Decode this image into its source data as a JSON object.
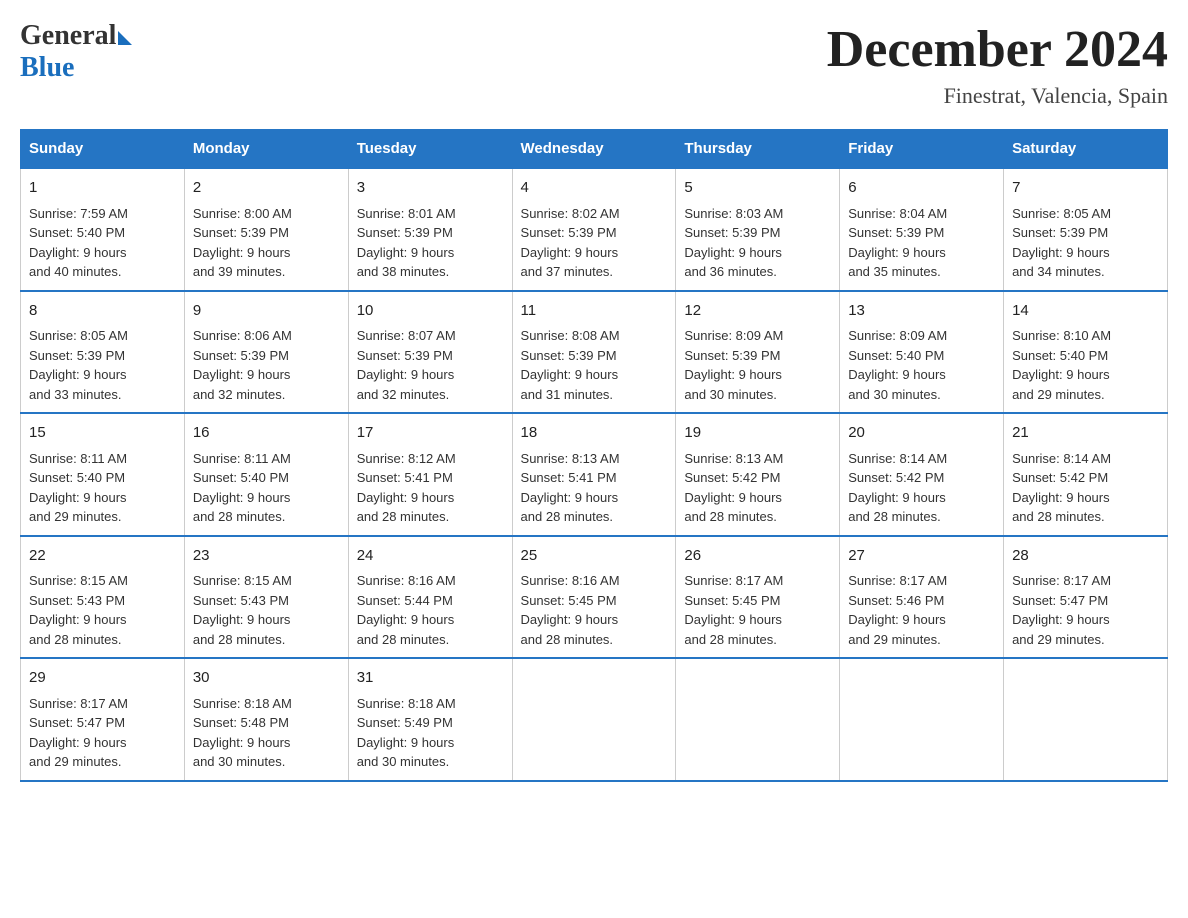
{
  "logo": {
    "general": "General",
    "blue": "Blue"
  },
  "header": {
    "month": "December 2024",
    "location": "Finestrat, Valencia, Spain"
  },
  "days_of_week": [
    "Sunday",
    "Monday",
    "Tuesday",
    "Wednesday",
    "Thursday",
    "Friday",
    "Saturday"
  ],
  "weeks": [
    [
      {
        "day": "1",
        "sunrise": "7:59 AM",
        "sunset": "5:40 PM",
        "daylight": "9 hours and 40 minutes."
      },
      {
        "day": "2",
        "sunrise": "8:00 AM",
        "sunset": "5:39 PM",
        "daylight": "9 hours and 39 minutes."
      },
      {
        "day": "3",
        "sunrise": "8:01 AM",
        "sunset": "5:39 PM",
        "daylight": "9 hours and 38 minutes."
      },
      {
        "day": "4",
        "sunrise": "8:02 AM",
        "sunset": "5:39 PM",
        "daylight": "9 hours and 37 minutes."
      },
      {
        "day": "5",
        "sunrise": "8:03 AM",
        "sunset": "5:39 PM",
        "daylight": "9 hours and 36 minutes."
      },
      {
        "day": "6",
        "sunrise": "8:04 AM",
        "sunset": "5:39 PM",
        "daylight": "9 hours and 35 minutes."
      },
      {
        "day": "7",
        "sunrise": "8:05 AM",
        "sunset": "5:39 PM",
        "daylight": "9 hours and 34 minutes."
      }
    ],
    [
      {
        "day": "8",
        "sunrise": "8:05 AM",
        "sunset": "5:39 PM",
        "daylight": "9 hours and 33 minutes."
      },
      {
        "day": "9",
        "sunrise": "8:06 AM",
        "sunset": "5:39 PM",
        "daylight": "9 hours and 32 minutes."
      },
      {
        "day": "10",
        "sunrise": "8:07 AM",
        "sunset": "5:39 PM",
        "daylight": "9 hours and 32 minutes."
      },
      {
        "day": "11",
        "sunrise": "8:08 AM",
        "sunset": "5:39 PM",
        "daylight": "9 hours and 31 minutes."
      },
      {
        "day": "12",
        "sunrise": "8:09 AM",
        "sunset": "5:39 PM",
        "daylight": "9 hours and 30 minutes."
      },
      {
        "day": "13",
        "sunrise": "8:09 AM",
        "sunset": "5:40 PM",
        "daylight": "9 hours and 30 minutes."
      },
      {
        "day": "14",
        "sunrise": "8:10 AM",
        "sunset": "5:40 PM",
        "daylight": "9 hours and 29 minutes."
      }
    ],
    [
      {
        "day": "15",
        "sunrise": "8:11 AM",
        "sunset": "5:40 PM",
        "daylight": "9 hours and 29 minutes."
      },
      {
        "day": "16",
        "sunrise": "8:11 AM",
        "sunset": "5:40 PM",
        "daylight": "9 hours and 28 minutes."
      },
      {
        "day": "17",
        "sunrise": "8:12 AM",
        "sunset": "5:41 PM",
        "daylight": "9 hours and 28 minutes."
      },
      {
        "day": "18",
        "sunrise": "8:13 AM",
        "sunset": "5:41 PM",
        "daylight": "9 hours and 28 minutes."
      },
      {
        "day": "19",
        "sunrise": "8:13 AM",
        "sunset": "5:42 PM",
        "daylight": "9 hours and 28 minutes."
      },
      {
        "day": "20",
        "sunrise": "8:14 AM",
        "sunset": "5:42 PM",
        "daylight": "9 hours and 28 minutes."
      },
      {
        "day": "21",
        "sunrise": "8:14 AM",
        "sunset": "5:42 PM",
        "daylight": "9 hours and 28 minutes."
      }
    ],
    [
      {
        "day": "22",
        "sunrise": "8:15 AM",
        "sunset": "5:43 PM",
        "daylight": "9 hours and 28 minutes."
      },
      {
        "day": "23",
        "sunrise": "8:15 AM",
        "sunset": "5:43 PM",
        "daylight": "9 hours and 28 minutes."
      },
      {
        "day": "24",
        "sunrise": "8:16 AM",
        "sunset": "5:44 PM",
        "daylight": "9 hours and 28 minutes."
      },
      {
        "day": "25",
        "sunrise": "8:16 AM",
        "sunset": "5:45 PM",
        "daylight": "9 hours and 28 minutes."
      },
      {
        "day": "26",
        "sunrise": "8:17 AM",
        "sunset": "5:45 PM",
        "daylight": "9 hours and 28 minutes."
      },
      {
        "day": "27",
        "sunrise": "8:17 AM",
        "sunset": "5:46 PM",
        "daylight": "9 hours and 29 minutes."
      },
      {
        "day": "28",
        "sunrise": "8:17 AM",
        "sunset": "5:47 PM",
        "daylight": "9 hours and 29 minutes."
      }
    ],
    [
      {
        "day": "29",
        "sunrise": "8:17 AM",
        "sunset": "5:47 PM",
        "daylight": "9 hours and 29 minutes."
      },
      {
        "day": "30",
        "sunrise": "8:18 AM",
        "sunset": "5:48 PM",
        "daylight": "9 hours and 30 minutes."
      },
      {
        "day": "31",
        "sunrise": "8:18 AM",
        "sunset": "5:49 PM",
        "daylight": "9 hours and 30 minutes."
      },
      null,
      null,
      null,
      null
    ]
  ],
  "labels": {
    "sunrise": "Sunrise:",
    "sunset": "Sunset:",
    "daylight": "Daylight:"
  }
}
